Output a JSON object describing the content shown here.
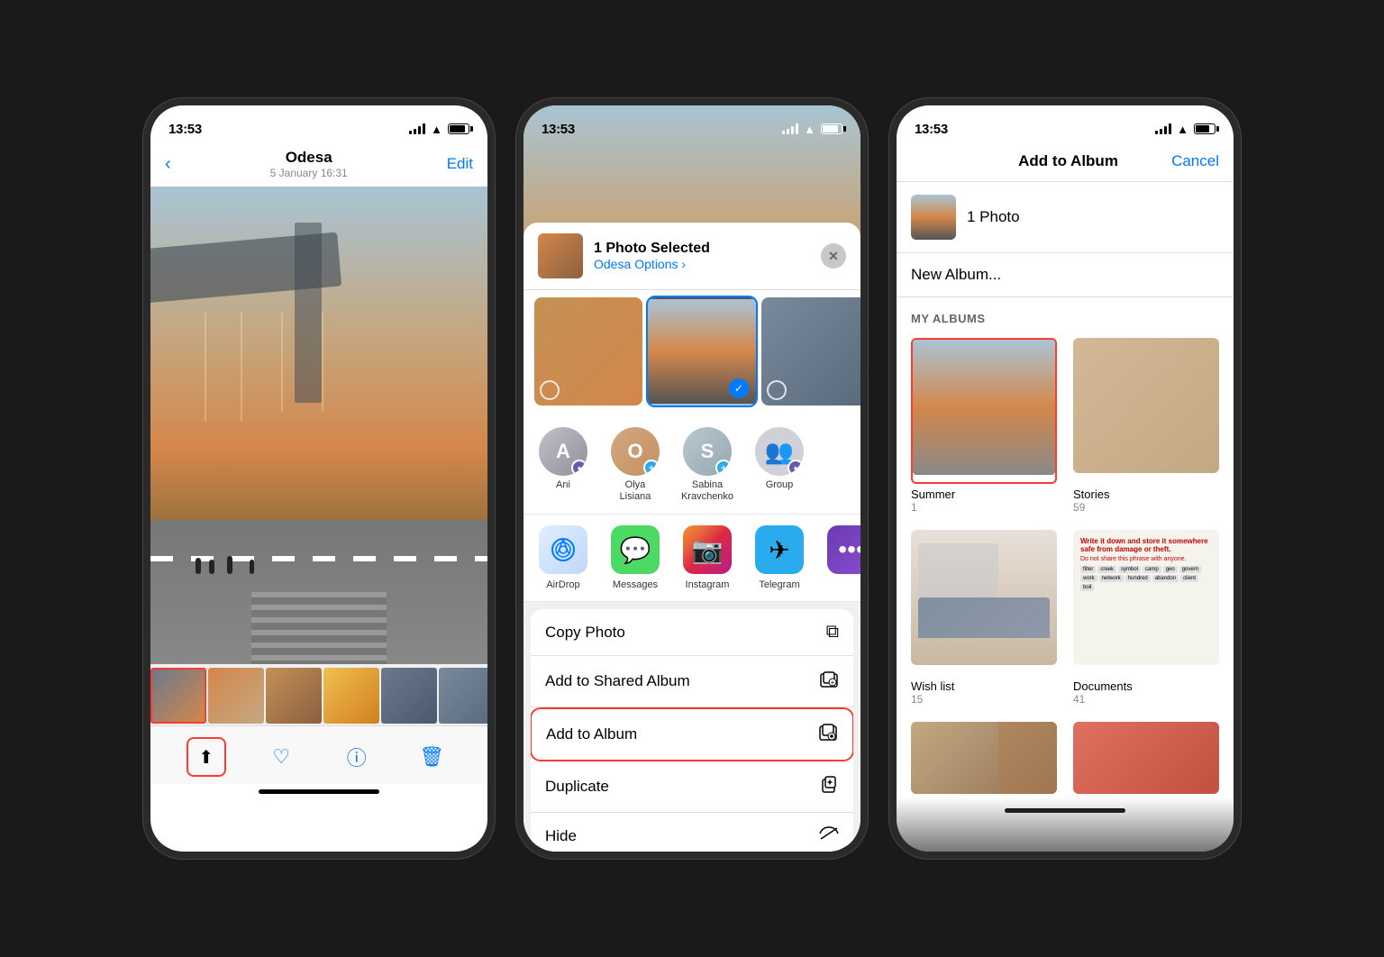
{
  "colors": {
    "ios_blue": "#007AFF",
    "ios_red": "#FF3B30",
    "ios_green": "#4CD964",
    "ios_gray": "#8e8e93",
    "black": "#000",
    "white": "#fff"
  },
  "phone1": {
    "status_time": "13:53",
    "nav_back_label": "‹",
    "nav_title": "Odesa",
    "nav_subtitle": "5 January  16:31",
    "nav_edit": "Edit",
    "bottom_toolbar": {
      "share_label": "share",
      "heart_label": "heart",
      "info_label": "info",
      "trash_label": "trash"
    }
  },
  "phone2": {
    "status_time": "13:53",
    "share_header": {
      "title": "1 Photo Selected",
      "subtitle": "Odesa",
      "options_label": "Options ›",
      "close_label": "✕"
    },
    "contacts": [
      {
        "name": "Ani",
        "badge": "viber",
        "badge_emoji": "💜"
      },
      {
        "name": "Olya\nLisiana",
        "badge": "telegram",
        "badge_emoji": "✈"
      },
      {
        "name": "Sabina\nKravchenko",
        "badge": "telegram",
        "badge_emoji": "✈"
      },
      {
        "name": "Group",
        "badge": "viber",
        "badge_emoji": "💜"
      }
    ],
    "apps": [
      {
        "name": "AirDrop",
        "type": "airdrop"
      },
      {
        "name": "Messages",
        "type": "messages"
      },
      {
        "name": "Instagram",
        "type": "instagram"
      },
      {
        "name": "Telegram",
        "type": "telegram"
      }
    ],
    "actions": [
      {
        "label": "Copy Photo",
        "icon": "⧉"
      },
      {
        "label": "Add to Shared Album",
        "icon": "☁"
      },
      {
        "label": "Add to Album",
        "icon": "🗂",
        "highlighted": true
      },
      {
        "label": "Duplicate",
        "icon": "⊕"
      },
      {
        "label": "Hide",
        "icon": "👁"
      }
    ]
  },
  "phone3": {
    "status_time": "13:53",
    "nav_title": "Add to Album",
    "nav_cancel": "Cancel",
    "photo_count": "1 Photo",
    "new_album_label": "New Album...",
    "my_albums_header": "My Albums",
    "albums": [
      {
        "name": "Summer",
        "count": "1",
        "selected": true
      },
      {
        "name": "Stories",
        "count": "59",
        "selected": false
      },
      {
        "name": "Wish list",
        "count": "15",
        "selected": false
      },
      {
        "name": "Documents",
        "count": "41",
        "selected": false
      }
    ]
  }
}
